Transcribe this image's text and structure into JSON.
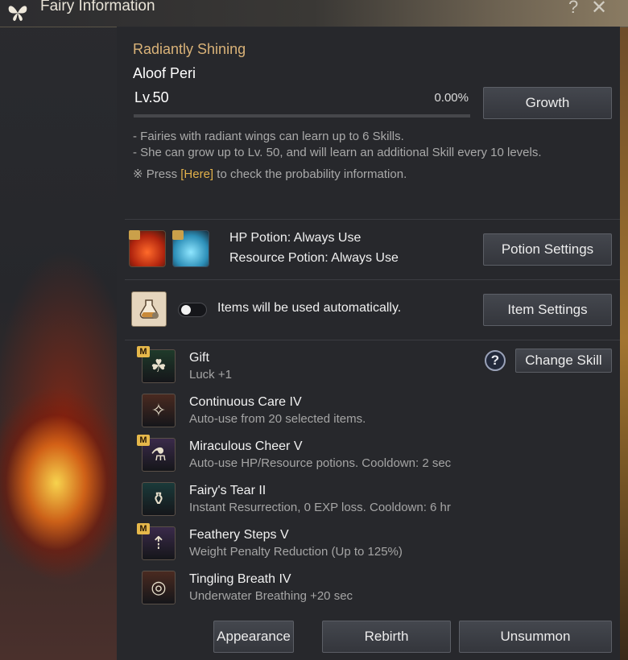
{
  "window": {
    "title": "Fairy Information",
    "help_glyph": "?",
    "close_glyph": "✕"
  },
  "fairy": {
    "title": "Radiantly Shining",
    "name": "Aloof Peri",
    "level": "Lv.50",
    "progress_text": "0.00%",
    "progress_fraction": 0.0,
    "growth_label": "Growth"
  },
  "description": {
    "line1": "- Fairies with radiant wings can learn up to 6 Skills.",
    "line2": "- She can grow up to Lv. 50, and will learn an additional Skill every 10 levels.",
    "note_prefix": "※ Press ",
    "note_link": "[Here]",
    "note_suffix": " to check the probability information."
  },
  "potions": {
    "hp_text": "HP Potion: Always Use",
    "resource_text": "Resource Potion: Always Use",
    "button_label": "Potion Settings"
  },
  "items": {
    "auto_text": "Items will be used automatically.",
    "button_label": "Item Settings",
    "toggle_on": false
  },
  "skills_header": {
    "help_glyph": "?",
    "change_label": "Change Skill"
  },
  "skills": [
    {
      "name": "Gift",
      "desc": "Luck +1",
      "badge": "M",
      "icon": "clover-icon",
      "color": "#1f3a2a"
    },
    {
      "name": "Continuous Care IV",
      "desc": "Auto-use from 20 selected items.",
      "badge": "",
      "icon": "fairy-icon",
      "color": "#4a2a20"
    },
    {
      "name": "Miraculous Cheer V",
      "desc": "Auto-use HP/Resource potions. Cooldown: 2 sec",
      "badge": "M",
      "icon": "potion-plus-icon",
      "color": "#3a2a4a"
    },
    {
      "name": "Fairy's Tear II",
      "desc": "Instant Resurrection, 0 EXP loss. Cooldown: 6 hr",
      "badge": "",
      "icon": "vase-icon",
      "color": "#1a3a3a"
    },
    {
      "name": "Feathery Steps V",
      "desc": "Weight Penalty Reduction (Up to 125%)",
      "badge": "M",
      "icon": "weight-icon",
      "color": "#3a2a4a"
    },
    {
      "name": "Tingling Breath IV",
      "desc": "Underwater Breathing +20 sec",
      "badge": "",
      "icon": "breath-icon",
      "color": "#4a2a20"
    }
  ],
  "actions": {
    "appearance": "Appearance",
    "rebirth": "Rebirth",
    "unsummon": "Unsummon"
  },
  "colors": {
    "accent": "#d9b278",
    "link": "#e1b04a",
    "badge": "#e6b84a"
  }
}
